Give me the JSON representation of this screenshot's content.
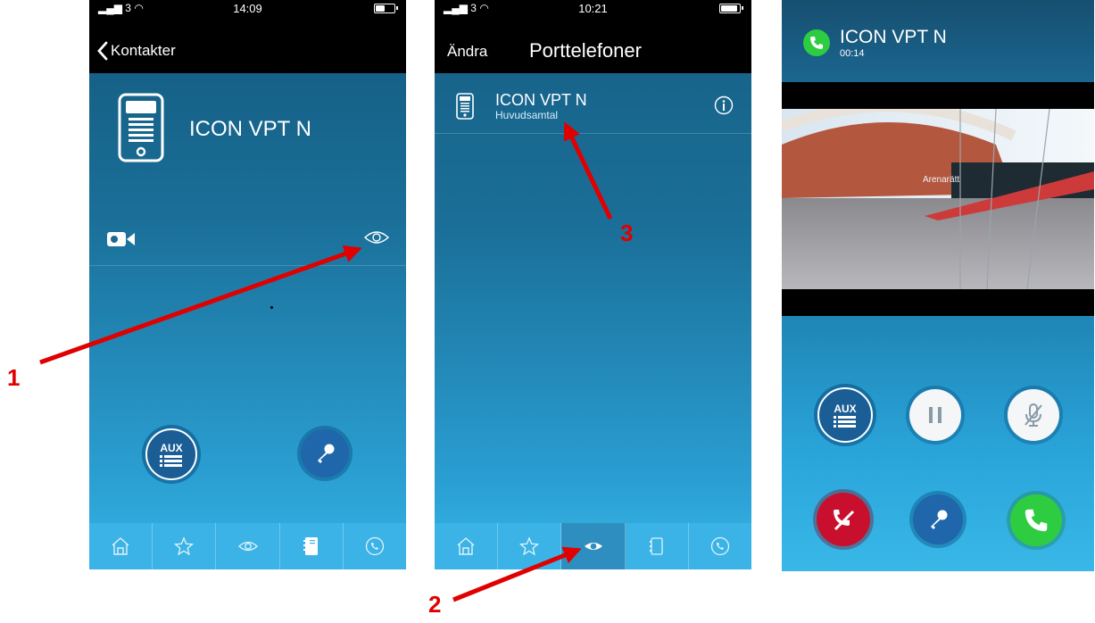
{
  "screen1": {
    "status": {
      "signal": "3",
      "time": "14:09"
    },
    "back_label": "Kontakter",
    "device_name": "ICON VPT N",
    "tabs": [
      "home-icon",
      "star-icon",
      "eye-icon",
      "contacts-icon",
      "call-log-icon"
    ]
  },
  "screen2": {
    "status": {
      "signal": "3",
      "time": "10:21"
    },
    "edit_label": "Ändra",
    "title": "Porttelefoner",
    "item": {
      "name": "ICON VPT N",
      "subtitle": "Huvudsamtal"
    },
    "tabs": [
      "home-icon",
      "star-icon",
      "eye-icon",
      "device-icon",
      "call-log-icon"
    ],
    "active_tab": "eye-icon"
  },
  "screen3": {
    "caller": "ICON VPT N",
    "duration": "00:14",
    "video_sign": "Arenarätt",
    "buttons": [
      "aux-button",
      "pause-button",
      "mute-button",
      "hangup-button",
      "key-button",
      "answer-button"
    ]
  },
  "annotations": {
    "label1": "1",
    "label2": "2",
    "label3": "3"
  },
  "colors": {
    "accent_red": "#e00000",
    "answer_green": "#2ecc40",
    "hangup_red": "#c8102e",
    "tab_blue": "#3bb3e6"
  }
}
